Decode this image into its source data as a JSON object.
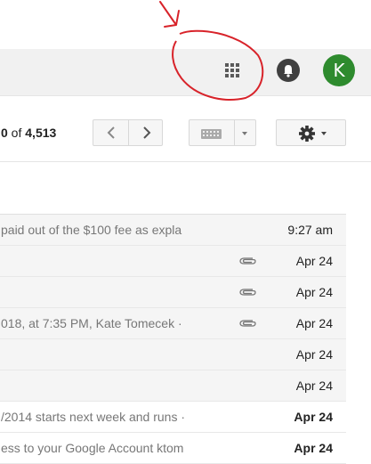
{
  "header": {
    "apps_icon": "apps-grid-icon",
    "notifications_icon": "bell-icon",
    "account_initial": "K",
    "avatar_color": "#2e8b2e",
    "annotation_color": "#d8232a"
  },
  "toolbar": {
    "pager": {
      "range_end": "0",
      "of_label": " of ",
      "total": "4,513"
    },
    "prev_icon": "chevron-left-icon",
    "next_icon": "chevron-right-icon",
    "keyboard_icon": "keyboard-icon",
    "settings_icon": "gear-icon"
  },
  "messages": [
    {
      "snippet": "paid out of the $100 fee as expla",
      "attachment": false,
      "date": "9:27 am",
      "unread": false
    },
    {
      "snippet": "",
      "attachment": true,
      "date": "Apr 24",
      "unread": false
    },
    {
      "snippet": "",
      "attachment": true,
      "date": "Apr 24",
      "unread": false
    },
    {
      "snippet": "018, at 7:35 PM, Kate Tomecek ·",
      "attachment": true,
      "date": "Apr 24",
      "unread": false
    },
    {
      "snippet": "",
      "attachment": false,
      "date": "Apr 24",
      "unread": false
    },
    {
      "snippet": "",
      "attachment": false,
      "date": "Apr 24",
      "unread": false
    },
    {
      "snippet": "/2014 starts next week and runs ·",
      "attachment": false,
      "date": "Apr 24",
      "unread": true
    },
    {
      "snippet": "ess to your Google Account ktom",
      "attachment": false,
      "date": "Apr 24",
      "unread": true
    }
  ]
}
